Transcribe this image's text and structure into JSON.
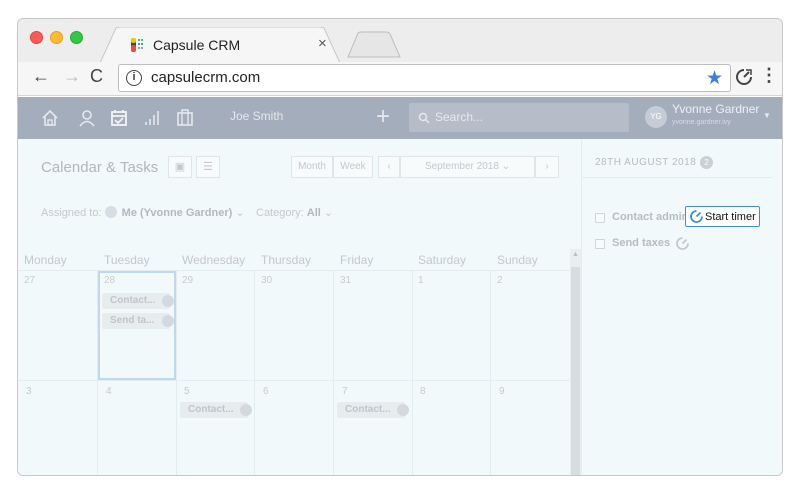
{
  "browser": {
    "tab_title": "Capsule CRM",
    "tab_close": "×",
    "url": "capsulecrm.com",
    "nav_back": "←",
    "nav_forward": "→",
    "nav_reload": "C",
    "info_glyph": "i",
    "star_glyph": "★",
    "menu_glyph": "⋮"
  },
  "header": {
    "current_user": "Joe Smith",
    "add_glyph": "+",
    "search_placeholder": "Search...",
    "avatar_initials": "YG",
    "user_name": "Yvonne Gardner",
    "user_email": "yvonne.gardner.ivy",
    "icons": [
      "home-icon",
      "person-icon",
      "calendar-check-icon",
      "bar-chart-icon",
      "briefcase-icon"
    ]
  },
  "calendar": {
    "title": "Calendar & Tasks",
    "view_calendar_glyph": "▣",
    "view_list_glyph": "☰",
    "view_modes": [
      "Month",
      "Week"
    ],
    "prev_glyph": "‹",
    "month_label": "September 2018 ⌄",
    "next_glyph": "›",
    "assigned_label": "Assigned to:",
    "assigned_value": "Me (Yvonne Gardner)",
    "assigned_caret": "⌄",
    "category_label": "Category:",
    "category_value": "All",
    "category_caret": "⌄",
    "weekdays": [
      "Monday",
      "Tuesday",
      "Wednesday",
      "Thursday",
      "Friday",
      "Saturday",
      "Sunday"
    ],
    "week1_days": [
      "27",
      "28",
      "29",
      "30",
      "31",
      "1",
      "2"
    ],
    "week2_days": [
      "3",
      "4",
      "5",
      "6",
      "7",
      "8",
      "9"
    ],
    "tasks": {
      "tue_1": "Contact...",
      "tue_2": "Send ta...",
      "wed_next": "Contact...",
      "fri_next": "Contact..."
    },
    "scroll_up_glyph": "▲"
  },
  "sidebar": {
    "date_heading": "28TH AUGUST 2018",
    "task_count": "2",
    "tasks": [
      {
        "label": "Contact admin"
      },
      {
        "label": "Send taxes"
      }
    ],
    "start_timer_label": "Start timer"
  },
  "colors": {
    "accent": "#3a8ee6",
    "app_header": "#a4adbc",
    "background": "#f2f9fa"
  }
}
